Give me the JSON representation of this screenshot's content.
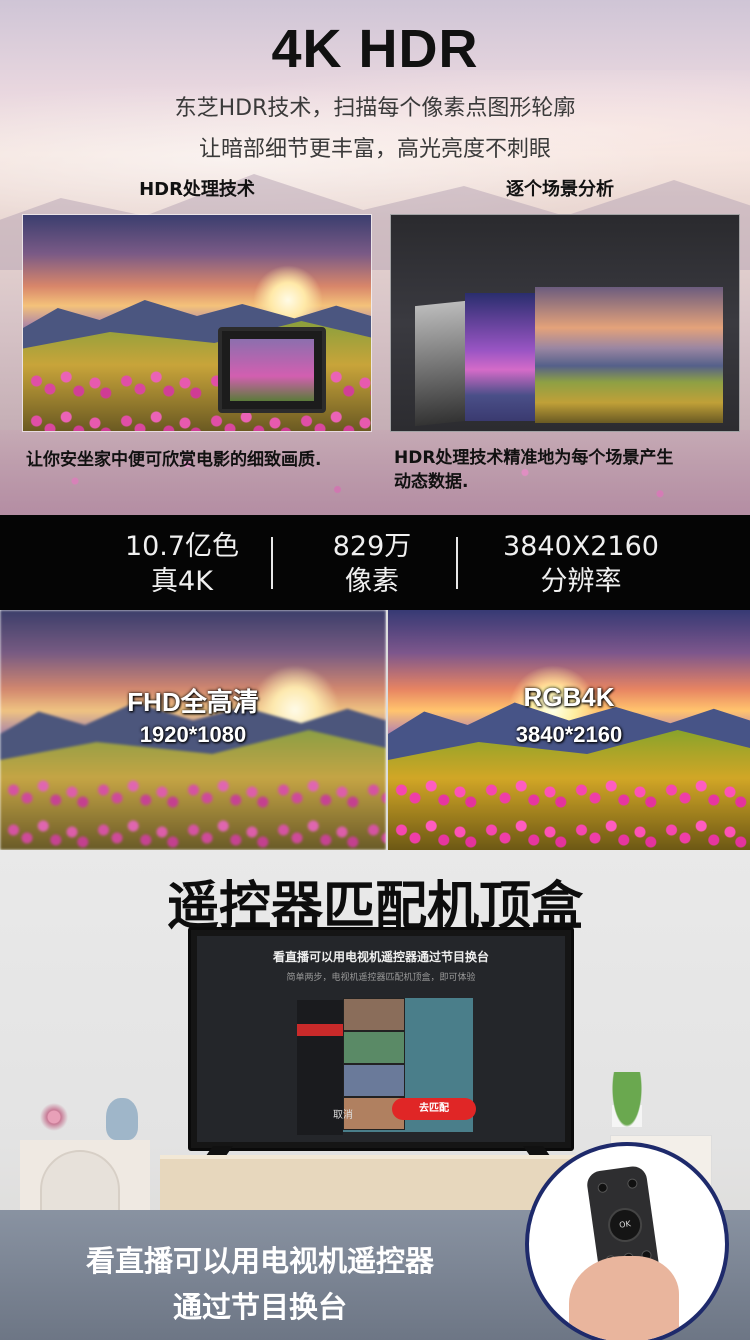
{
  "hero": {
    "title": "4K HDR",
    "line1": "东芝HDR技术，扫描每个像素点图形轮廓",
    "line2": "让暗部细节更丰富，高光亮度不刺眼",
    "left_label": "HDR处理技术",
    "right_label": "逐个场景分析",
    "left_caption": "让你安坐家中便可欣赏电影的细致画质.",
    "right_caption_1": "HDR处理技术精准地为每个场景产生",
    "right_caption_2": "动态数据."
  },
  "specs": [
    {
      "value": "10.7亿色",
      "label": "真4K"
    },
    {
      "value": "829万",
      "label": "像素"
    },
    {
      "value": "3840X2160",
      "label": "分辨率"
    }
  ],
  "compare": {
    "left_title": "FHD全高清",
    "left_sub": "1920*1080",
    "right_title": "RGB4K",
    "right_sub": "3840*2160"
  },
  "remote": {
    "title": "遥控器匹配机顶盒",
    "tv_heading": "看直播可以用电视机遥控器通过节目换台",
    "tv_sub": "简单两步，电视机遥控器匹配机顶盒，即可体验",
    "tv_cancel": "取消",
    "tv_go": "去匹配",
    "banner_line1": "看直播可以用电视机遥控器",
    "banner_line2": "通过节目换台"
  }
}
